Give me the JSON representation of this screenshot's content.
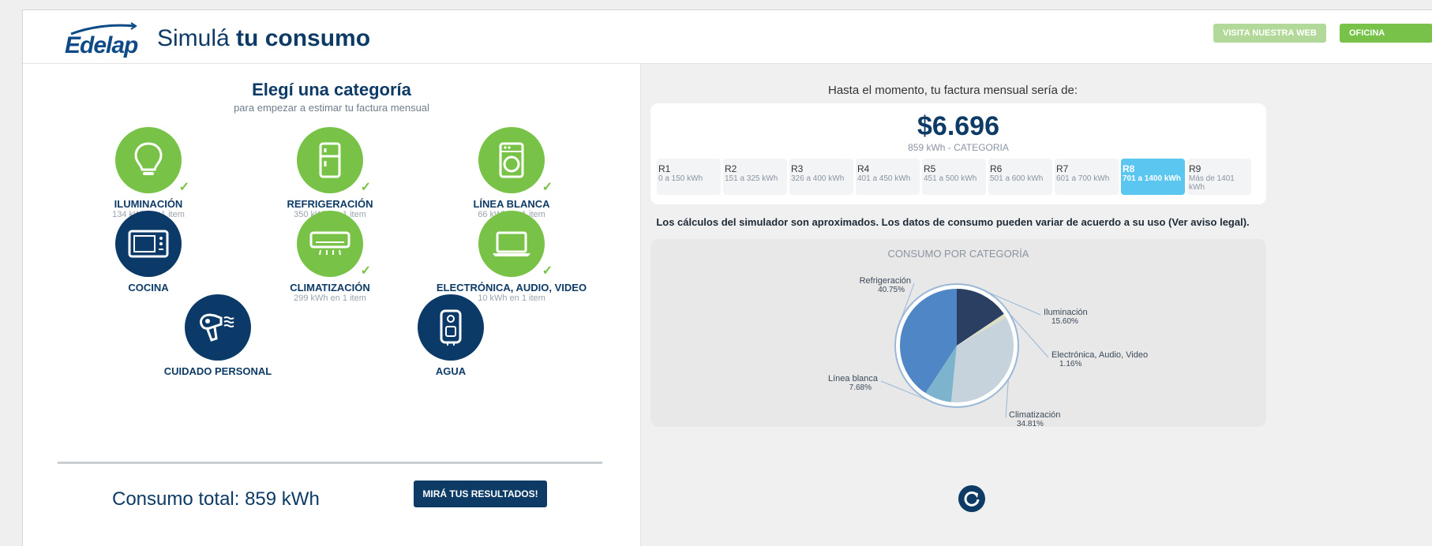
{
  "header": {
    "logo_text": "Edelap",
    "title_light": "Simulá",
    "title_bold": "tu consumo",
    "btn_web": "VISITA NUESTRA WEB",
    "btn_office": "OFICINA VIRTUAL"
  },
  "left": {
    "title": "Elegí una categoría",
    "subtitle": "para empezar a estimar tu factura mensual",
    "categories": [
      {
        "name": "ILUMINACIÓN",
        "info": "134 kWh en 1 item",
        "icon": "lightbulb-icon",
        "selected": true
      },
      {
        "name": "REFRIGERACIÓN",
        "info": "350 kWh en 1 item",
        "icon": "fridge-icon",
        "selected": true
      },
      {
        "name": "LÍNEA BLANCA",
        "info": "66 kWh en 1 item",
        "icon": "washing-machine-icon",
        "selected": true
      },
      {
        "name": "COCINA",
        "info": "",
        "icon": "microwave-icon",
        "selected": false
      },
      {
        "name": "CLIMATIZACIÓN",
        "info": "299 kWh en 1 item",
        "icon": "air-conditioner-icon",
        "selected": true
      },
      {
        "name": "ELECTRÓNICA, AUDIO, VIDEO",
        "info": "10 kWh en 1 item",
        "icon": "laptop-icon",
        "selected": true
      },
      {
        "name": "CUIDADO PERSONAL",
        "info": "",
        "icon": "hair-dryer-icon",
        "selected": false
      },
      {
        "name": "AGUA",
        "info": "",
        "icon": "water-heater-icon",
        "selected": false
      }
    ],
    "total_label": "Consumo total: 859 kWh",
    "results_button": "MIRÁ TUS RESULTADOS!"
  },
  "right": {
    "subtitle": "Hasta el momento, tu factura mensual sería de:",
    "amount": "$6.696",
    "detail": "859 kWh - CATEGORIA",
    "ranges": [
      {
        "code": "R1",
        "range": "0 a 150 kWh"
      },
      {
        "code": "R2",
        "range": "151 a 325 kWh"
      },
      {
        "code": "R3",
        "range": "326 a 400 kWh"
      },
      {
        "code": "R4",
        "range": "401 a 450 kWh"
      },
      {
        "code": "R5",
        "range": "451 a 500 kWh"
      },
      {
        "code": "R6",
        "range": "501 a 600 kWh"
      },
      {
        "code": "R7",
        "range": "601 a 700 kWh"
      },
      {
        "code": "R8",
        "range": "701 a 1400 kWh",
        "active": true
      },
      {
        "code": "R9",
        "range": "Más de 1401 kWh"
      }
    ],
    "disclaimer": "Los cálculos del simulador son aproximados. Los datos de consumo pueden variar de acuerdo a su uso (Ver aviso legal)."
  },
  "chart_data": {
    "type": "pie",
    "title": "CONSUMO POR CATEGORÍA",
    "slices": [
      {
        "label": "Iluminación",
        "value": 15.6,
        "display": "15.60%",
        "color": "#2b3f63"
      },
      {
        "label": "Electrónica, Audio, Video",
        "value": 1.16,
        "display": "1.16%",
        "color": "#dcdfc1"
      },
      {
        "label": "Climatización",
        "value": 34.81,
        "display": "34.81%",
        "color": "#c6d3dc"
      },
      {
        "label": "Línea blanca",
        "value": 7.68,
        "display": "7.68%",
        "color": "#7eb3cd"
      },
      {
        "label": "Refrigeración",
        "value": 40.75,
        "display": "40.75%",
        "color": "#4f86c6"
      }
    ]
  },
  "colors": {
    "brand_navy": "#0d3b66",
    "brand_green": "#78c347",
    "active_range": "#5bc6ef"
  }
}
